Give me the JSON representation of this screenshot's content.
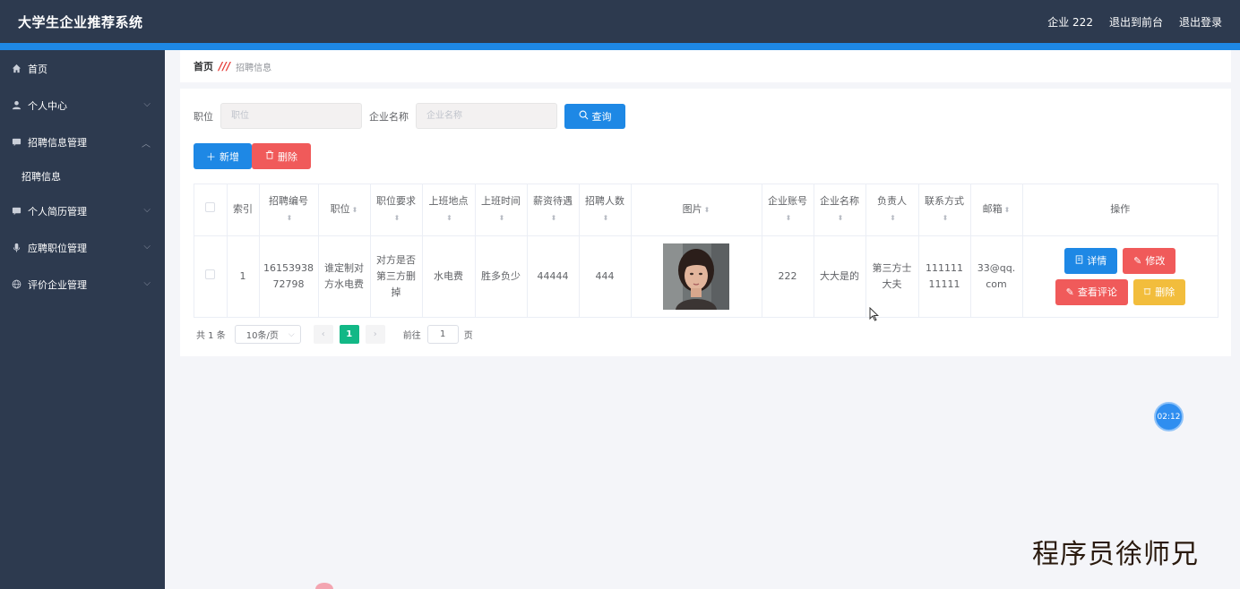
{
  "header": {
    "title": "大学生企业推荐系统",
    "user": "企业 222",
    "to_front": "退出到前台",
    "logout": "退出登录"
  },
  "sidebar": {
    "items": [
      {
        "label": "首页",
        "icon": "home-icon"
      },
      {
        "label": "个人中心",
        "icon": "user-icon"
      },
      {
        "label": "招聘信息管理",
        "icon": "chat-icon"
      },
      {
        "label": "招聘信息",
        "icon": ""
      },
      {
        "label": "个人简历管理",
        "icon": "chat-icon"
      },
      {
        "label": "应聘职位管理",
        "icon": "mic-icon"
      },
      {
        "label": "评价企业管理",
        "icon": "globe-icon"
      }
    ]
  },
  "breadcrumb": {
    "home": "首页",
    "current": "招聘信息"
  },
  "search": {
    "position_label": "职位",
    "position_placeholder": "职位",
    "company_label": "企业名称",
    "company_placeholder": "企业名称",
    "query_button": "查询"
  },
  "actions": {
    "add": "新增",
    "delete": "删除"
  },
  "table": {
    "headers": {
      "index": "索引",
      "job_no": "招聘编号",
      "position": "职位",
      "requirements": "职位要求",
      "location": "上班地点",
      "work_time": "上班时间",
      "salary": "薪资待遇",
      "headcount": "招聘人数",
      "image": "图片",
      "account": "企业账号",
      "company": "企业名称",
      "contact_person": "负责人",
      "phone": "联系方式",
      "email": "邮箱",
      "ops": "操作"
    },
    "rows": [
      {
        "index": "1",
        "job_no": "1615393872798",
        "position": "谁定制对方水电费",
        "requirements": "对方是否第三方删掉",
        "location": "水电费",
        "work_time": "胜多负少",
        "salary": "44444",
        "headcount": "444",
        "account": "222",
        "company": "大大是的",
        "contact_person": "第三方士大夫",
        "phone": "11111111111",
        "email": "33@qq.com",
        "btn_detail": "详情",
        "btn_edit": "修改",
        "btn_review": "查看评论",
        "btn_remove": "删除"
      }
    ]
  },
  "pagination": {
    "total": "共 1 条",
    "page_size": "10条/页",
    "current_page": "1",
    "goto_label": "前往",
    "goto_value": "1",
    "page_unit": "页"
  },
  "overlay": {
    "timer": "02:12",
    "watermark": "程序员徐师兄"
  },
  "colors": {
    "primary": "#1e88e5",
    "danger": "#f05a5a",
    "warning": "#f2bd3c",
    "sidebar_bg": "#2d3a4f",
    "page_active": "#12b886"
  }
}
